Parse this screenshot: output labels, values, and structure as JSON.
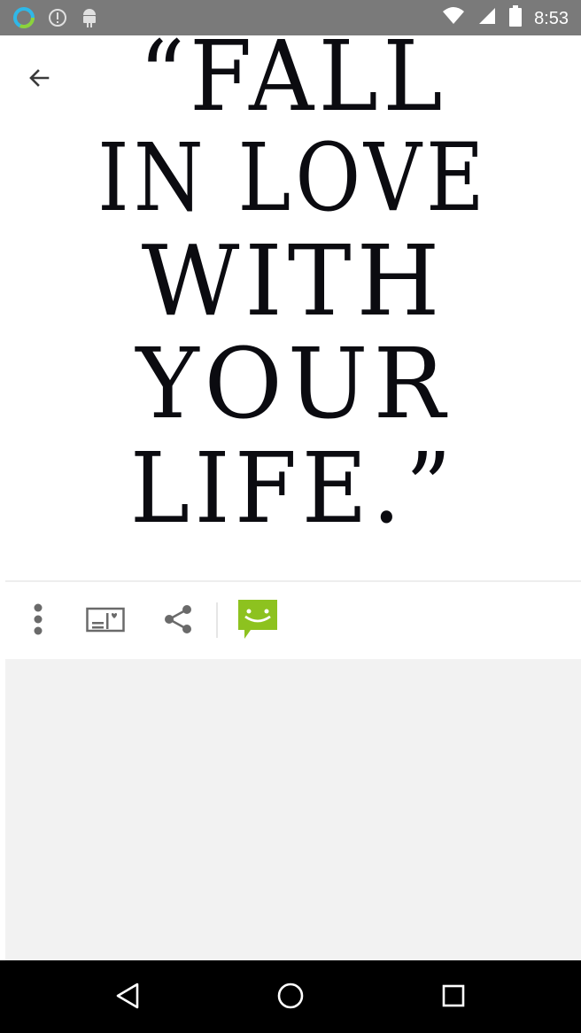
{
  "status_bar": {
    "time": "8:53",
    "icons": [
      "ring-status-icon",
      "info-status-icon",
      "android-status-icon",
      "wifi-icon",
      "signal-icon",
      "battery-icon"
    ]
  },
  "quote": {
    "lines": [
      "“FALL",
      "IN LOVE",
      "WITH",
      "YOUR",
      "LIFE.”"
    ]
  },
  "top_bar": {
    "back_icon": "back-arrow-icon"
  },
  "toolbar": {
    "buttons": [
      "more-options-icon",
      "postcard-icon",
      "share-icon",
      "chat-smiley-icon"
    ],
    "chat_color": "#8dc21f"
  },
  "nav_bar": {
    "buttons": [
      "back-triangle-icon",
      "home-circle-icon",
      "recents-square-icon"
    ]
  }
}
